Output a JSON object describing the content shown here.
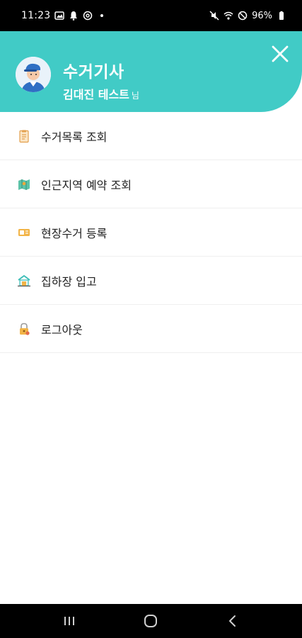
{
  "status_bar": {
    "time": "11:23",
    "battery": "96%",
    "left_icons": [
      "gallery-icon",
      "bell-icon",
      "at-sign-icon",
      "dot-icon"
    ],
    "right_icons": [
      "mute-icon",
      "wifi-icon",
      "do-not-disturb-icon",
      "battery-icon"
    ]
  },
  "header": {
    "role": "수거기사",
    "user_name": "김대진 테스트",
    "user_suffix": "님",
    "background": "#41cbc6"
  },
  "menu": {
    "items": [
      {
        "label": "수거목록 조회",
        "icon": "clipboard-list-icon"
      },
      {
        "label": "인근지역 예약 조회",
        "icon": "map-icon"
      },
      {
        "label": "현장수거 등록",
        "icon": "ticket-icon"
      },
      {
        "label": "집하장 입고",
        "icon": "warehouse-icon"
      },
      {
        "label": "로그아웃",
        "icon": "lock-icon"
      }
    ]
  },
  "nav_bar": {
    "buttons": [
      "recent-apps-icon",
      "home-icon",
      "back-icon"
    ]
  }
}
